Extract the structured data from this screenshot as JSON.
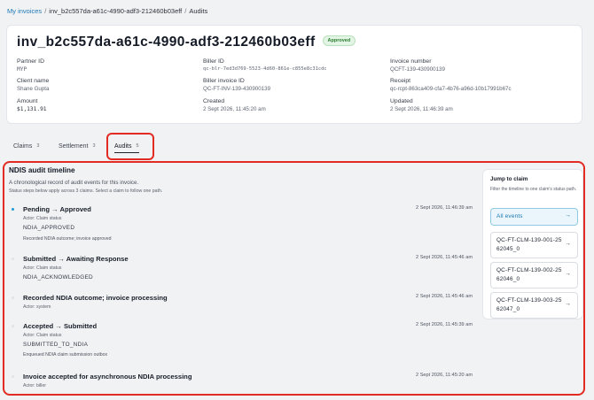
{
  "breadcrumb": {
    "root": "My invoices",
    "invoice": "inv_b2c557da-a61c-4990-adf3-212460b03eff",
    "current": "Audits",
    "separator": "/"
  },
  "header": {
    "title": "inv_b2c557da-a61c-4990-adf3-212460b03eff",
    "status": "Approved",
    "fields": {
      "partner_id": {
        "label": "Partner ID",
        "value": "MYP"
      },
      "biller_id": {
        "label": "Biller ID",
        "value": "qc-blr-7ed3d769-5523-4d60-861e-c855e8c31cdc"
      },
      "invoice_number": {
        "label": "Invoice number",
        "value": "QCFT-139-430900139"
      },
      "client_name": {
        "label": "Client name",
        "value": "Shane Gupta"
      },
      "biller_invoice_id": {
        "label": "Biller invoice ID",
        "value": "QC-FT-INV-139-430900139"
      },
      "receipt": {
        "label": "Receipt",
        "value": "qc-rcpt-863ca409-cfa7-4b76-a96d-10b17991b67c"
      },
      "amount": {
        "label": "Amount",
        "value": "$1,131.91"
      },
      "created": {
        "label": "Created",
        "value": "2 Sept 2026, 11:45:20 am"
      },
      "updated": {
        "label": "Updated",
        "value": "2 Sept 2026, 11:46:39 am"
      }
    }
  },
  "tabs": [
    {
      "label": "Claims",
      "count": "3"
    },
    {
      "label": "Settlement",
      "count": "3"
    },
    {
      "label": "Audits",
      "count": "5"
    }
  ],
  "audits": {
    "title": "NDIS audit timeline",
    "description": "A chronological record of audit events for this invoice.",
    "hint": "Status steps below apply across 3 claims. Select a claim to follow one path.",
    "events": [
      {
        "title": "Pending → Approved",
        "time": "2 Sept 2026, 11:46:39 am",
        "actor": "Actor: Claim status",
        "code": "NDIA_APPROVED",
        "note": "Recorded NDIA outcome; invoice approved"
      },
      {
        "title": "Submitted → Awaiting Response",
        "time": "2 Sept 2026, 11:45:46 am",
        "actor": "Actor: Claim status",
        "code": "NDIA_ACKNOWLEDGED",
        "note": ""
      },
      {
        "title": "Recorded NDIA outcome; invoice processing",
        "time": "2 Sept 2026, 11:45:46 am",
        "actor": "Actor: system",
        "code": "",
        "note": ""
      },
      {
        "title": "Accepted → Submitted",
        "time": "2 Sept 2026, 11:45:39 am",
        "actor": "Actor: Claim status",
        "code": "SUBMITTED_TO_NDIA",
        "note": "Enqueued NDIA claim submission outbox"
      },
      {
        "title": "Invoice accepted for asynchronous NDIA processing",
        "time": "2 Sept 2026, 11:45:20 am",
        "actor": "Actor: biller",
        "code": "",
        "note": ""
      }
    ]
  },
  "jump": {
    "title": "Jump to claim",
    "description": "Filter the timeline to one claim's status path.",
    "all_label": "All events",
    "claims": [
      {
        "line1": "QC-FT-CLM-139-001-25",
        "line2": "62045_0"
      },
      {
        "line1": "QC-FT-CLM-139-002-25",
        "line2": "62046_0"
      },
      {
        "line1": "QC-FT-CLM-139-003-25",
        "line2": "62047_0"
      }
    ],
    "arrow": "→"
  },
  "colors": {
    "link": "#1f78b4",
    "highlight_red": "#e22b22",
    "approved_green": "#2e7d32",
    "active_dot": "#1f9bd6"
  }
}
